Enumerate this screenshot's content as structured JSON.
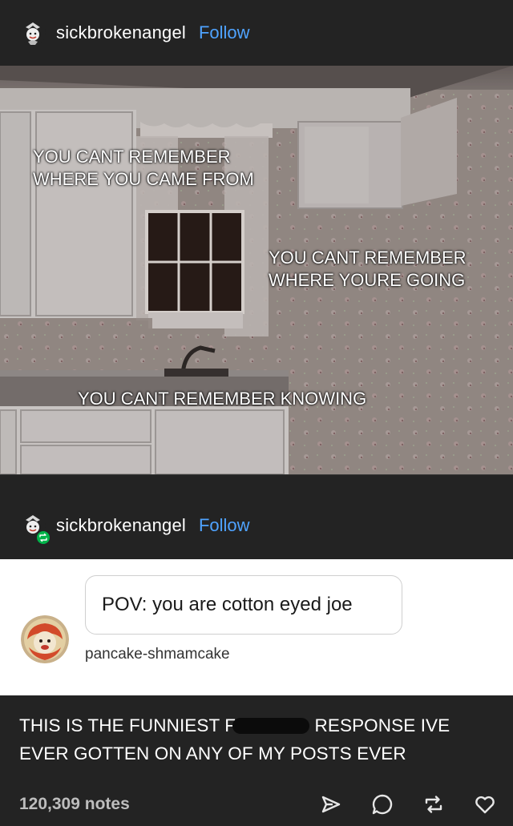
{
  "post": {
    "username": "sickbrokenangel",
    "follow_label": "Follow"
  },
  "meme": {
    "caption_1": "YOU CANT REMEMBER\nWHERE YOU CAME FROM",
    "caption_2": "YOU CANT REMEMBER\nWHERE YOURE GOING",
    "caption_3": "YOU CANT REMEMBER KNOWING"
  },
  "reblog": {
    "username": "sickbrokenangel",
    "follow_label": "Follow"
  },
  "ask": {
    "question": "POV: you are cotton eyed joe",
    "asker": "pancake-shmamcake"
  },
  "answer": {
    "line_1_before": "THIS IS THE FUNNIEST F",
    "line_1_after": "RESPONSE IVE",
    "line_2": "EVER GOTTEN ON ANY OF MY POSTS EVER"
  },
  "footer": {
    "notes": "120,309 notes"
  },
  "colors": {
    "background": "#232323",
    "accent_link": "#4fa3ff",
    "reblog_green": "#00b34a"
  },
  "icons": [
    "share-icon",
    "comment-icon",
    "reblog-icon",
    "like-icon"
  ]
}
